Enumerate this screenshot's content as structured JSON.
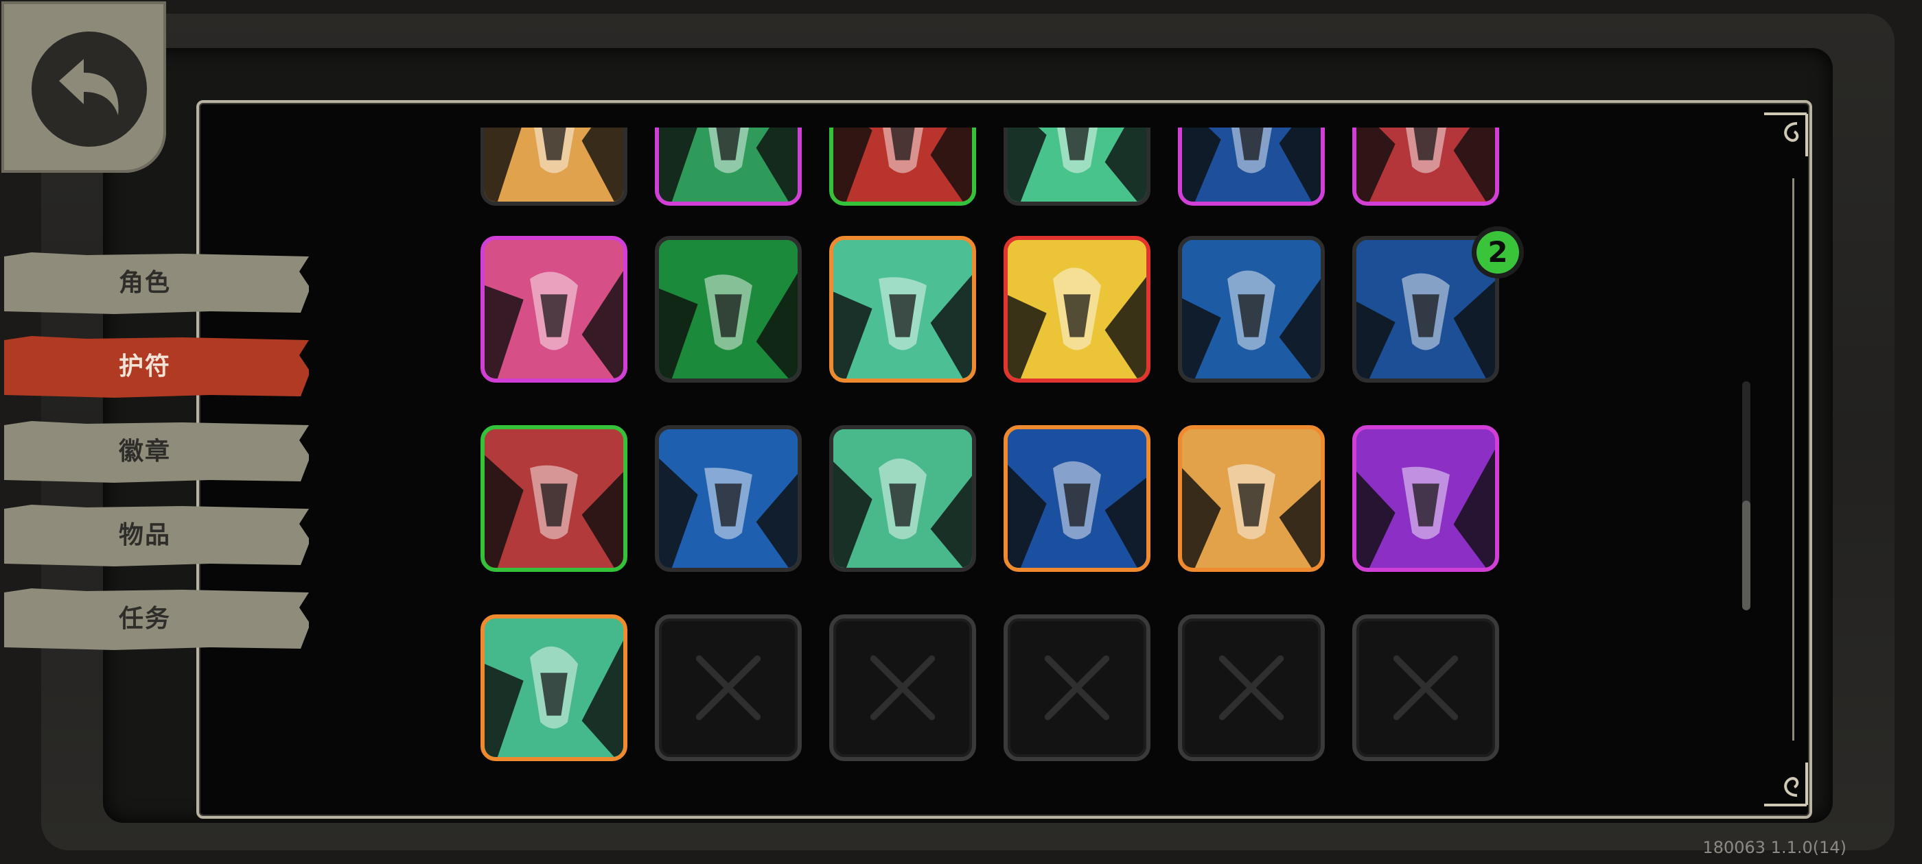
{
  "menu": {
    "tabs": [
      {
        "label": "角色",
        "active": false
      },
      {
        "label": "护符",
        "active": true
      },
      {
        "label": "徽章",
        "active": false
      },
      {
        "label": "物品",
        "active": false
      },
      {
        "label": "任务",
        "active": false
      }
    ]
  },
  "charms": {
    "rows": [
      [
        {
          "icon": "orange-claw-charm-icon",
          "rarity": "common",
          "bg": "#e0a24d",
          "border": "#2e2e2e"
        },
        {
          "icon": "green-blade-charm-icon",
          "rarity": "epic",
          "bg": "#2f9b5a",
          "border": "#d23fd6"
        },
        {
          "icon": "dagger-charm-icon",
          "rarity": "uncommon",
          "bg": "#b9342c",
          "border": "#34c23a"
        },
        {
          "icon": "green-spikes-charm-icon",
          "rarity": "common",
          "bg": "#49c38c",
          "border": "#2e2e2e"
        },
        {
          "icon": "blue-lightning-charm-icon",
          "rarity": "epic",
          "bg": "#1d4f9a",
          "border": "#d23fd6"
        },
        {
          "icon": "red-flame-charm-icon",
          "rarity": "epic",
          "bg": "#b5363a",
          "border": "#d23fd6"
        }
      ],
      [
        {
          "icon": "pointing-fist-charm-icon",
          "rarity": "epic",
          "bg": "#d64f86",
          "border": "#d23fd6"
        },
        {
          "icon": "green-fang-charm-icon",
          "rarity": "common",
          "bg": "#1c8a3b",
          "border": "#2e2e2e"
        },
        {
          "icon": "purple-bone-charm-icon",
          "rarity": "legendary",
          "bg": "#4dbf94",
          "border": "#ef8a2e"
        },
        {
          "icon": "arrow-trees-charm-icon",
          "rarity": "mythic",
          "bg": "#ecc437",
          "border": "#e3352f"
        },
        {
          "icon": "lightning-orb-charm-icon",
          "rarity": "common",
          "bg": "#1d5ba4",
          "border": "#2e2e2e"
        },
        {
          "icon": "lightning-fish-charm-icon",
          "rarity": "common",
          "bg": "#1c4f95",
          "border": "#2e2e2e",
          "count": "2"
        }
      ],
      [
        {
          "icon": "red-ribbon-charm-icon",
          "rarity": "uncommon",
          "bg": "#b33a3a",
          "border": "#34c23a"
        },
        {
          "icon": "ice-hand-charm-icon",
          "rarity": "common",
          "bg": "#1f5fb0",
          "border": "#2e2e2e"
        },
        {
          "icon": "golden-bullet-charm-icon",
          "rarity": "common",
          "bg": "#49b98c",
          "border": "#2e2e2e"
        },
        {
          "icon": "running-figure-charm-icon",
          "rarity": "legendary",
          "bg": "#1b4fa0",
          "border": "#ef8a2e"
        },
        {
          "icon": "crystal-shard-charm-icon",
          "rarity": "legendary",
          "bg": "#e2a24a",
          "border": "#ef8a2e"
        },
        {
          "icon": "purple-crown-charm-icon",
          "rarity": "epic",
          "bg": "#8b2fc5",
          "border": "#d23fd6"
        }
      ],
      [
        {
          "icon": "green-wind-charm-icon",
          "rarity": "legendary-ornate",
          "bg": "#45b98c",
          "border": "#ef8a2e"
        },
        {
          "icon": "empty-slot-icon",
          "empty": true
        },
        {
          "icon": "empty-slot-icon",
          "empty": true
        },
        {
          "icon": "empty-slot-icon",
          "empty": true
        },
        {
          "icon": "empty-slot-icon",
          "empty": true
        },
        {
          "icon": "empty-slot-icon",
          "empty": true
        }
      ]
    ]
  },
  "version": "180063 1.1.0(14)"
}
